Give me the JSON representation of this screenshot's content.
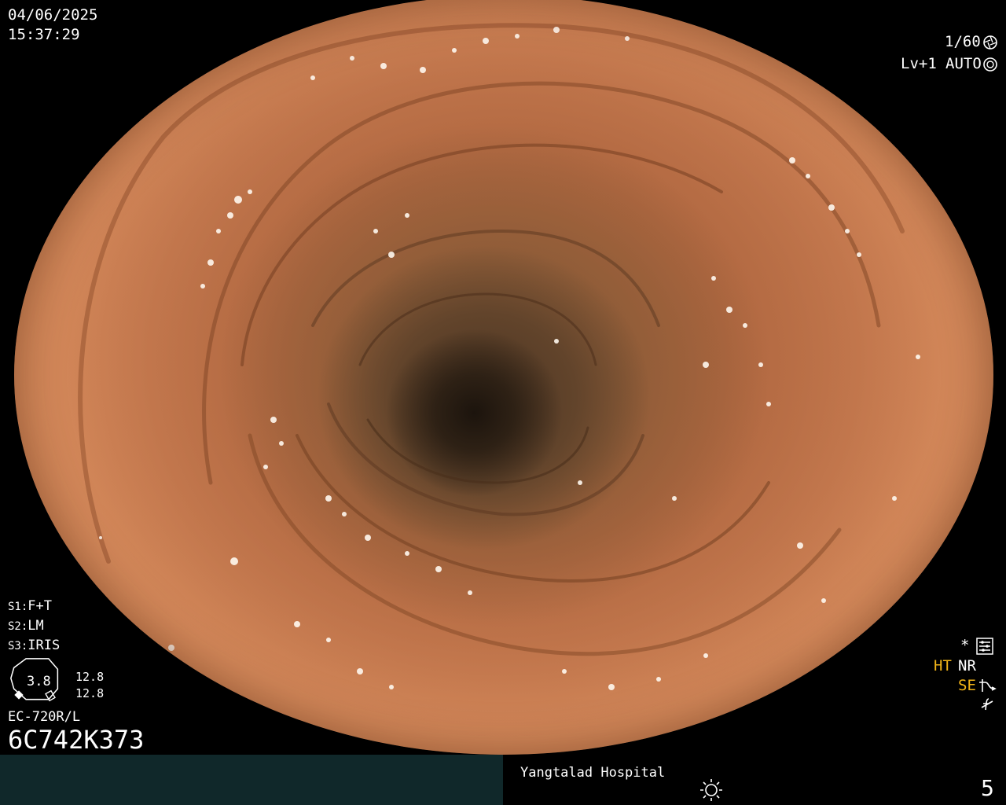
{
  "datetime": {
    "date": "04/06/2025",
    "time": "15:37:29"
  },
  "top_right": {
    "shutter": "1/60",
    "shutter_icon": "shutter-icon",
    "level": "Lv+1",
    "mode": "AUTO",
    "mode_icon": "auto-iris-icon"
  },
  "scope_settings": {
    "s1_key": "S1:",
    "s1_value": "F+T",
    "s2_key": "S2:",
    "s2_value": "LM",
    "s3_key": "S3:",
    "s3_value": "IRIS"
  },
  "iris_indicator": {
    "value": "3.8",
    "upper": "12.8",
    "lower": "12.8"
  },
  "scope": {
    "model": "EC-720R/L",
    "serial": "6C742K373"
  },
  "right_panel": {
    "star": "*",
    "menu_icon": "settings-menu-icon",
    "ht": "HT",
    "nr": "NR",
    "se": "SE",
    "se_icon": "curve-icon",
    "f_icon": "not-f-icon"
  },
  "bottom_bar": {
    "hospital": "Yangtalad Hospital",
    "light_icon": "sun-icon",
    "page_number": "5"
  },
  "colors": {
    "bottom_bar_left": "#10282a",
    "accent_yellow": "#f2b418",
    "mucosa": "#c0754a",
    "lumen": "#1c140d"
  }
}
